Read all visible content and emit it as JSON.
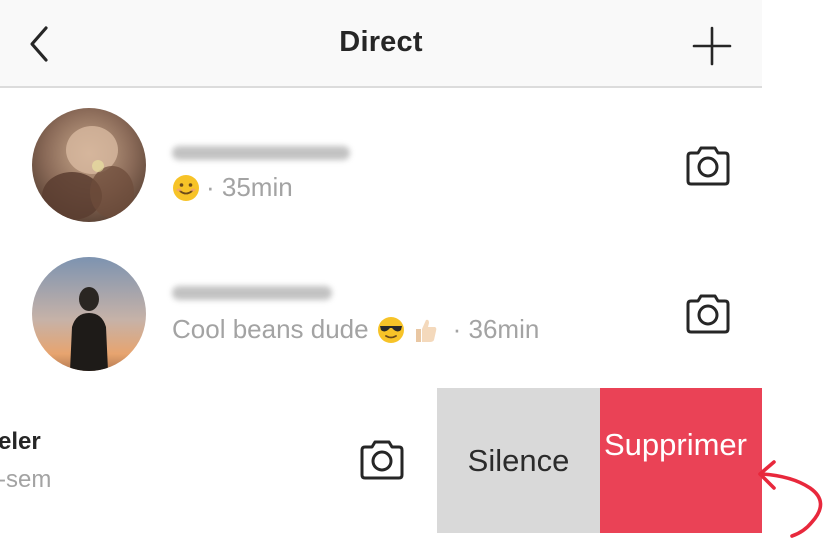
{
  "header": {
    "title": "Direct",
    "back_icon": "chevron-left-icon",
    "new_icon": "plus-icon"
  },
  "threads": [
    {
      "emoji": "smiling-face-emoji",
      "meta": "· 35min",
      "camera_icon": "camera-icon"
    },
    {
      "message": "Cool beans dude",
      "emojis": [
        "sunglasses-emoji",
        "thumbs-up-emoji"
      ],
      "meta": "· 36min",
      "camera_icon": "camera-icon"
    },
    {
      "name_partial": "eler",
      "meta_partial": "-sem",
      "camera_icon": "camera-icon"
    }
  ],
  "swipe_actions": {
    "silence_label": "Silence",
    "delete_label": "Supprimer"
  },
  "colors": {
    "header_bg": "#f9f9f9",
    "silence_bg": "#d9d9d9",
    "delete_bg": "#ea4256",
    "annotation_arrow": "#e8283c"
  },
  "annotation": {
    "arrow_icon": "curved-arrow-icon"
  }
}
